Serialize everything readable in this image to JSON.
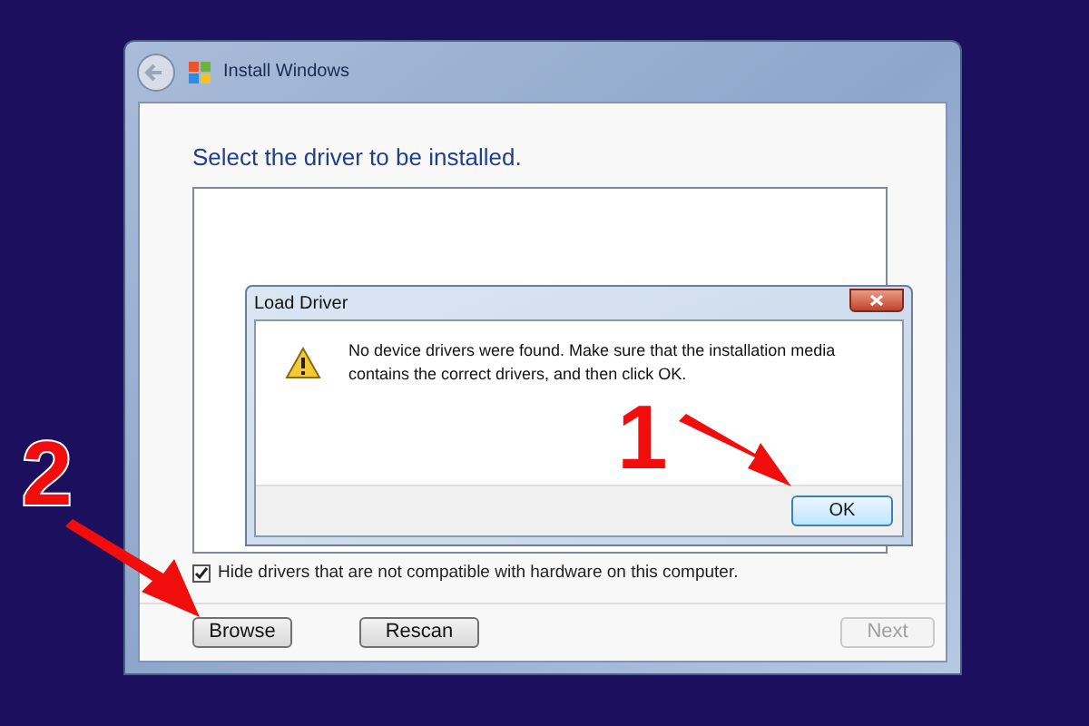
{
  "window": {
    "title": "Install Windows"
  },
  "heading": "Select the driver to be installed.",
  "dialog": {
    "title": "Load Driver",
    "message": "No device drivers were found. Make sure that the installation media contains the correct drivers, and then click OK.",
    "buttons": [
      {
        "label": "OK"
      }
    ]
  },
  "checkbox": {
    "label": "Hide drivers that are not compatible with hardware on this computer.",
    "checked": true
  },
  "buttons": [
    {
      "label": "Browse",
      "disabled": false
    },
    {
      "label": "Rescan",
      "disabled": false
    },
    {
      "label": "Next",
      "disabled": true
    }
  ],
  "annotations": [
    {
      "label": "1"
    },
    {
      "label": "2"
    }
  ]
}
